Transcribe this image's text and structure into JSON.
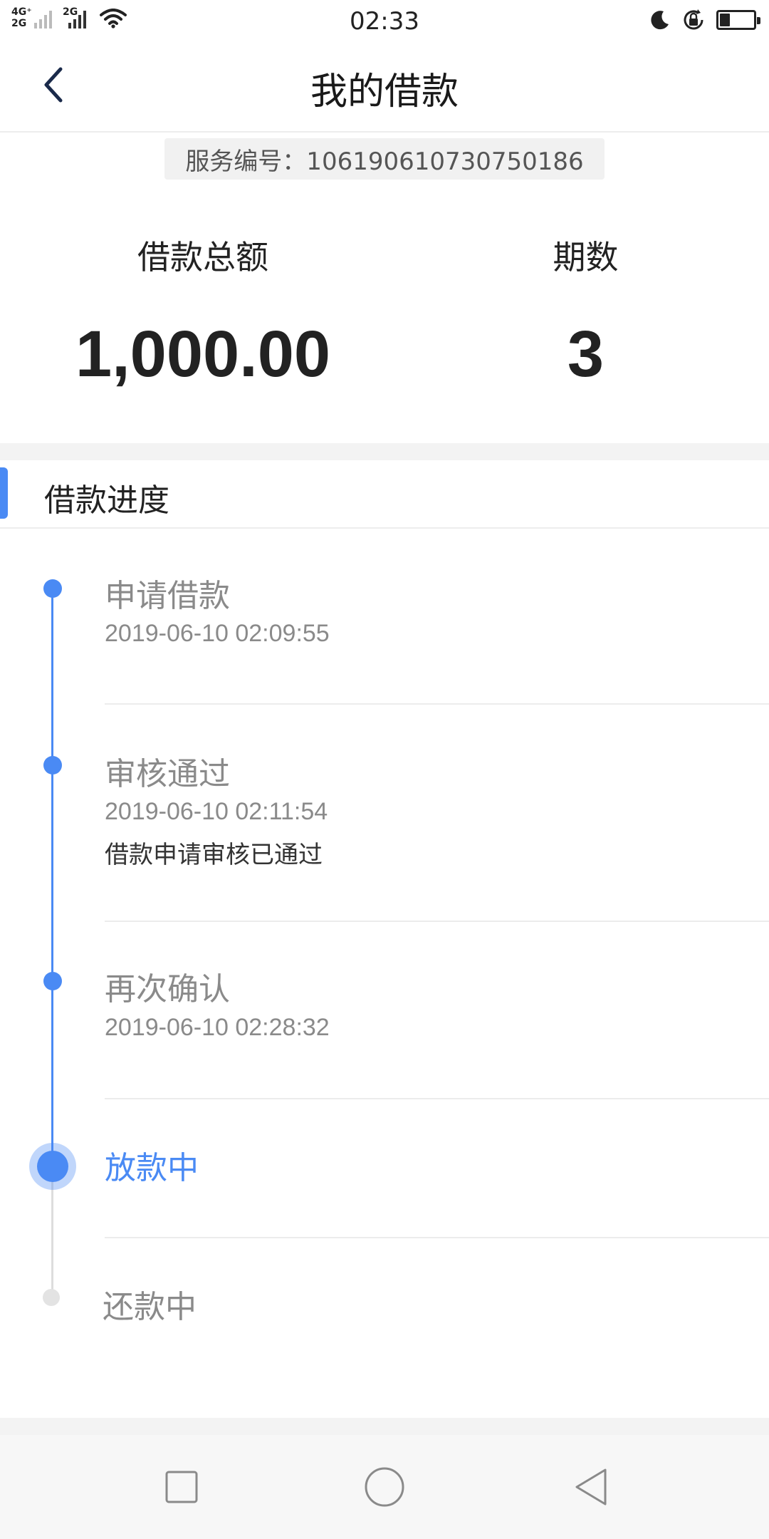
{
  "status_bar": {
    "time": "02:33",
    "network_1": "4G⁺",
    "network_2": "2G",
    "network_3": "2G",
    "battery_level": 0.3,
    "icons": [
      "signal-icon",
      "wifi-icon",
      "moon-icon",
      "rotation-lock-icon",
      "battery-icon"
    ]
  },
  "nav": {
    "title": "我的借款",
    "back_icon": "chevron-left-icon"
  },
  "service": {
    "text": "服务编号：106190610730750186"
  },
  "summary": {
    "amount_label": "借款总额",
    "amount_value": "1,000.00",
    "periods_label": "期数",
    "periods_value": "3"
  },
  "progress": {
    "section_title": "借款进度",
    "accent_color": "#4a8af4",
    "steps": [
      {
        "title": "申请借款",
        "time": "2019-06-10 02:09:55",
        "note": "",
        "status": "done"
      },
      {
        "title": "审核通过",
        "time": "2019-06-10 02:11:54",
        "note": "借款申请审核已通过",
        "status": "done"
      },
      {
        "title": "再次确认",
        "time": "2019-06-10 02:28:32",
        "note": "",
        "status": "done"
      },
      {
        "title": "放款中",
        "time": "",
        "note": "",
        "status": "current"
      },
      {
        "title": "还款中",
        "time": "",
        "note": "",
        "status": "pending"
      }
    ]
  },
  "system_nav": {
    "icons": [
      "recents-square-icon",
      "home-circle-icon",
      "back-triangle-icon"
    ]
  }
}
